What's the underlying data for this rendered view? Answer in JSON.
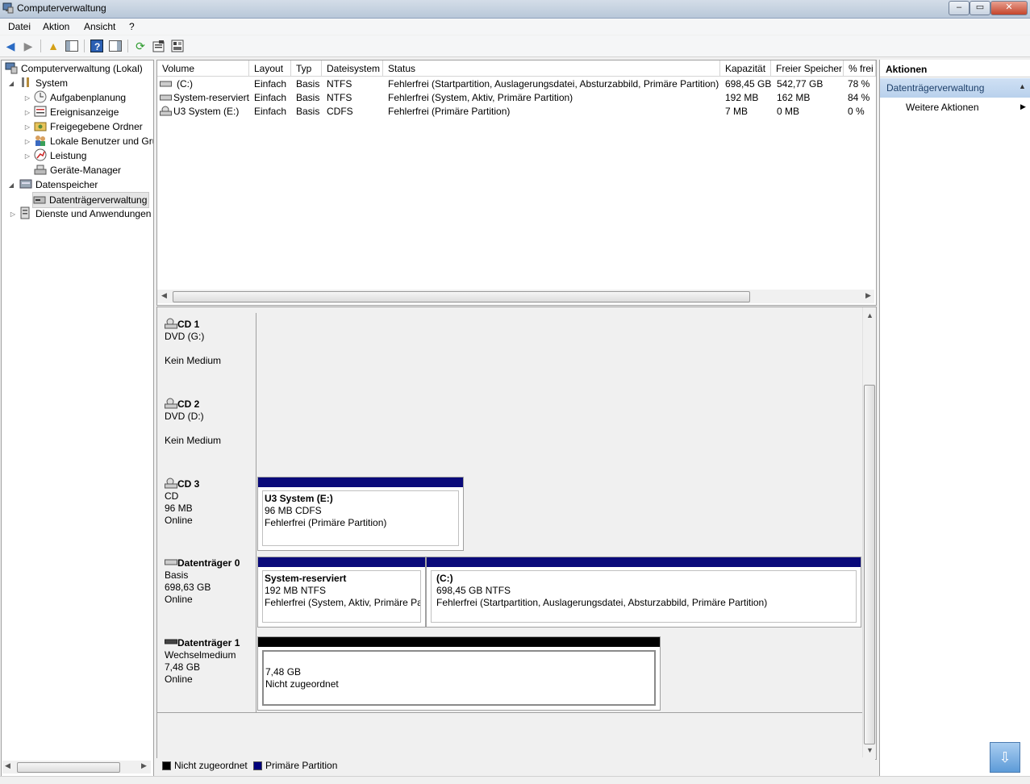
{
  "window": {
    "title": "Computerverwaltung"
  },
  "menu": [
    "Datei",
    "Aktion",
    "Ansicht",
    "?"
  ],
  "tree": {
    "root": "Computerverwaltung (Lokal)",
    "items": [
      {
        "label": "System",
        "icon": "tools-icon"
      },
      {
        "label": "Aufgabenplanung",
        "icon": "clock-icon"
      },
      {
        "label": "Ereignisanzeige",
        "icon": "event-viewer-icon"
      },
      {
        "label": "Freigegebene Ordner",
        "icon": "shared-folder-icon"
      },
      {
        "label": "Lokale Benutzer und Gruppen",
        "icon": "users-icon"
      },
      {
        "label": "Leistung",
        "icon": "performance-icon"
      },
      {
        "label": "Geräte-Manager",
        "icon": "device-manager-icon"
      },
      {
        "label": "Datenspeicher",
        "icon": "storage-icon"
      },
      {
        "label": "Datenträgerverwaltung",
        "icon": "disk-management-icon"
      },
      {
        "label": "Dienste und Anwendungen",
        "icon": "services-icon"
      }
    ]
  },
  "volumes": {
    "columns": [
      "Volume",
      "Layout",
      "Typ",
      "Dateisystem",
      "Status",
      "Kapazität",
      "Freier Speicher",
      "% frei"
    ],
    "rows": [
      [
        "(C:)",
        "Einfach",
        "Basis",
        "NTFS",
        "Fehlerfrei (Startpartition, Auslagerungsdatei, Absturzabbild, Primäre Partition)",
        "698,45 GB",
        "542,77 GB",
        "78 %"
      ],
      [
        "System-reserviert",
        "Einfach",
        "Basis",
        "NTFS",
        "Fehlerfrei (System, Aktiv, Primäre Partition)",
        "192 MB",
        "162 MB",
        "84 %"
      ],
      [
        "U3 System (E:)",
        "Einfach",
        "Basis",
        "CDFS",
        "Fehlerfrei (Primäre Partition)",
        "7 MB",
        "0 MB",
        "0 %"
      ]
    ]
  },
  "disks": [
    {
      "name": "CD 1",
      "line1": "DVD (G:)",
      "line2": "",
      "line3": "Kein Medium"
    },
    {
      "name": "CD 2",
      "line1": "DVD (D:)",
      "line2": "",
      "line3": "Kein Medium"
    },
    {
      "name": "CD 3",
      "line1": "CD",
      "line2": "96 MB",
      "line3": "Online",
      "partitions": [
        {
          "title": "U3 System  (E:)",
          "size": "96 MB CDFS",
          "status": "Fehlerfrei (Primäre Partition)"
        }
      ]
    },
    {
      "name": "Datenträger 0",
      "line1": "Basis",
      "line2": "698,63 GB",
      "line3": "Online",
      "partitions": [
        {
          "title": "System-reserviert",
          "size": "192 MB NTFS",
          "status": "Fehlerfrei (System, Aktiv, Primäre Partition)"
        },
        {
          "title": "(C:)",
          "size": "698,45 GB NTFS",
          "status": "Fehlerfrei (Startpartition, Auslagerungsdatei, Absturzabbild, Primäre Partition)"
        }
      ]
    },
    {
      "name": "Datenträger 1",
      "line1": "Wechselmedium",
      "line2": "7,48 GB",
      "line3": "Online",
      "partitions": [
        {
          "title": "",
          "size": "7,48 GB",
          "status": "Nicht zugeordnet"
        }
      ]
    }
  ],
  "legend": [
    {
      "label": "Nicht zugeordnet",
      "color": "#000000"
    },
    {
      "label": "Primäre Partition",
      "color": "#00007b"
    }
  ],
  "actions": {
    "header": "Aktionen",
    "section": "Datenträgerverwaltung",
    "more": "Weitere Aktionen"
  },
  "colors": {
    "primary_partition": "#0a0a7a",
    "unallocated": "#000000",
    "accent": "#c3d7ee"
  }
}
